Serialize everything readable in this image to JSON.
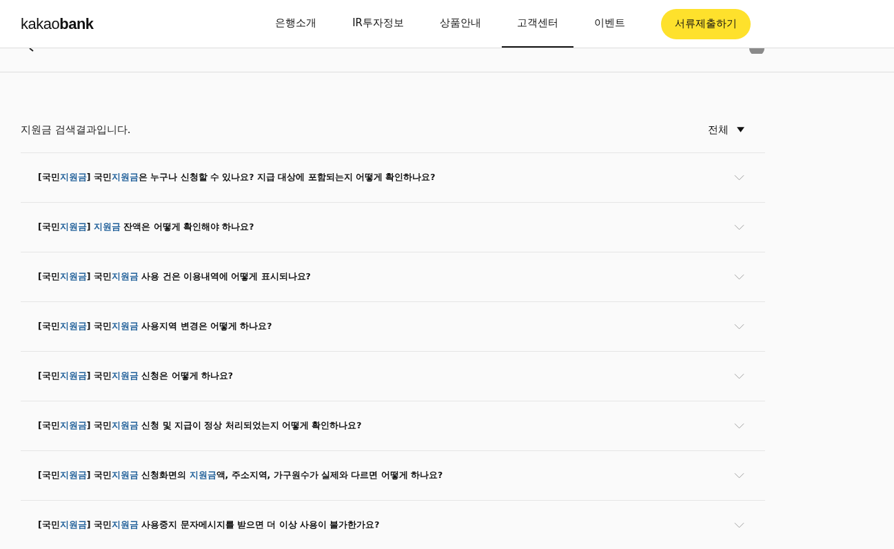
{
  "header": {
    "logo": {
      "light": "kakao",
      "bold": "bank"
    },
    "nav": [
      {
        "label": "은행소개",
        "selected": false
      },
      {
        "label": "IR투자정보",
        "selected": false
      },
      {
        "label": "상품안내",
        "selected": false
      },
      {
        "label": "고객센터",
        "selected": true
      },
      {
        "label": "이벤트",
        "selected": false
      }
    ],
    "cta_button": "서류제출하기"
  },
  "results": {
    "title": "지원금 검색결과입니다.",
    "filter": "전체",
    "questions": [
      {
        "expanded": false,
        "segments": [
          {
            "text": "[국민",
            "highlight": false
          },
          {
            "text": "지원금",
            "highlight": true
          },
          {
            "text": "] 국민",
            "highlight": false
          },
          {
            "text": "지원금",
            "highlight": true
          },
          {
            "text": "은 누구나 신청할 수 있나요? 지급 대상에 포함되는지 어떻게 확인하나요?",
            "highlight": false
          }
        ]
      },
      {
        "expanded": false,
        "segments": [
          {
            "text": "[국민",
            "highlight": false
          },
          {
            "text": "지원금",
            "highlight": true
          },
          {
            "text": "] ",
            "highlight": false
          },
          {
            "text": "지원금",
            "highlight": true
          },
          {
            "text": " 잔액은 어떻게 확인해야 하나요?",
            "highlight": false
          }
        ]
      },
      {
        "expanded": false,
        "segments": [
          {
            "text": "[국민",
            "highlight": false
          },
          {
            "text": "지원금",
            "highlight": true
          },
          {
            "text": "] 국민",
            "highlight": false
          },
          {
            "text": "지원금",
            "highlight": true
          },
          {
            "text": " 사용 건은 이용내역에 어떻게 표시되나요?",
            "highlight": false
          }
        ]
      },
      {
        "expanded": false,
        "segments": [
          {
            "text": "[국민",
            "highlight": false
          },
          {
            "text": "지원금",
            "highlight": true
          },
          {
            "text": "] 국민",
            "highlight": false
          },
          {
            "text": "지원금",
            "highlight": true
          },
          {
            "text": " 사용지역 변경은 어떻게 하나요?",
            "highlight": false
          }
        ]
      },
      {
        "expanded": false,
        "segments": [
          {
            "text": "[국민",
            "highlight": false
          },
          {
            "text": "지원금",
            "highlight": true
          },
          {
            "text": "] 국민",
            "highlight": false
          },
          {
            "text": "지원금",
            "highlight": true
          },
          {
            "text": " 신청은 어떻게 하나요?",
            "highlight": false
          }
        ]
      },
      {
        "expanded": false,
        "segments": [
          {
            "text": "[국민",
            "highlight": false
          },
          {
            "text": "지원금",
            "highlight": true
          },
          {
            "text": "] 국민",
            "highlight": false
          },
          {
            "text": "지원금",
            "highlight": true
          },
          {
            "text": " 신청 및 지급이 정상 처리되었는지 어떻게 확인하나요?",
            "highlight": false
          }
        ]
      },
      {
        "expanded": false,
        "segments": [
          {
            "text": "[국민",
            "highlight": false
          },
          {
            "text": "지원금",
            "highlight": true
          },
          {
            "text": "] 국민",
            "highlight": false
          },
          {
            "text": "지원금",
            "highlight": true
          },
          {
            "text": " 신청화면의 ",
            "highlight": false
          },
          {
            "text": "지원금",
            "highlight": true
          },
          {
            "text": "액, 주소지역, 가구원수가 실제와 다르면 어떻게 하나요?",
            "highlight": false
          }
        ]
      },
      {
        "expanded": false,
        "segments": [
          {
            "text": "[국민",
            "highlight": false
          },
          {
            "text": "지원금",
            "highlight": true
          },
          {
            "text": "] 국민",
            "highlight": false
          },
          {
            "text": "지원금",
            "highlight": true
          },
          {
            "text": " 사용중지 문자메시지를 받으면 더 이상 사용이 불가한가요?",
            "highlight": false
          }
        ]
      }
    ]
  }
}
